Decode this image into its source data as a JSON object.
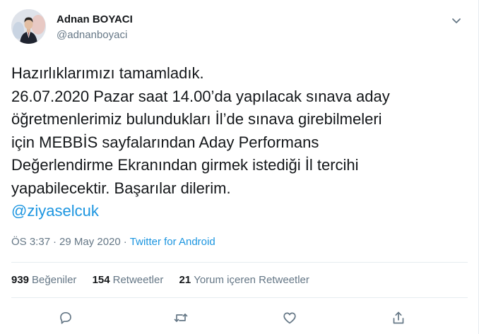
{
  "author": {
    "display_name": "Adnan BOYACI",
    "username": "@adnanboyaci"
  },
  "icons": {
    "caret": "chevron-down-icon",
    "reply": "reply-icon",
    "retweet": "retweet-icon",
    "like": "heart-icon",
    "share": "share-icon"
  },
  "tweet": {
    "lines": [
      "Hazırlıklarımızı tamamladık.",
      "26.07.2020 Pazar saat 14.00’da yapılacak sınava aday",
      "öğretmenlerimiz bulundukları İl’de sınava girebilmeleri",
      "için MEBBİS sayfalarından Aday Performans",
      "Değerlendirme Ekranından girmek istediği İl tercihi",
      "yapabilecektir. Başarılar dilerim."
    ],
    "mention": "@ziyaselcuk"
  },
  "meta": {
    "time": "ÖS 3:37",
    "separator": "·",
    "date": "29 May 2020",
    "source": "Twitter for Android"
  },
  "stats": {
    "likes_count": "939",
    "likes_label": "Beğeniler",
    "retweets_count": "154",
    "retweets_label": "Retweetler",
    "quotes_count": "21",
    "quotes_label": "Yorum içeren Retweetler"
  },
  "colors": {
    "link": "#1b95e0",
    "secondary_text": "#657786",
    "divider": "#e6ecf0"
  }
}
